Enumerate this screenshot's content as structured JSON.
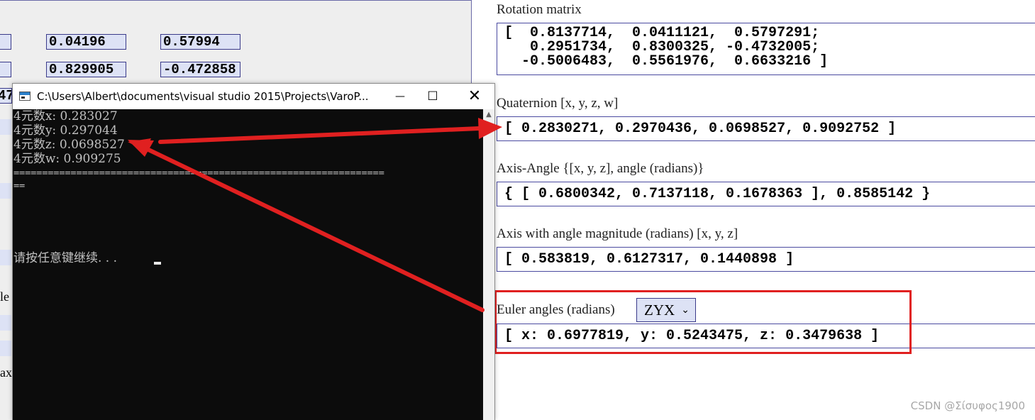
{
  "left_panel": {
    "row1": [
      "0.04196",
      "0.57994"
    ],
    "row2": [
      "0.829905",
      "-0.472858"
    ],
    "partial_row": "47",
    "fragments": [
      "le",
      "ax"
    ]
  },
  "console": {
    "title": "C:\\Users\\Albert\\documents\\visual studio 2015\\Projects\\VaroP...",
    "lines": [
      "4元数x: 0.283027",
      "4元数y: 0.297044",
      "4元数z: 0.0698527",
      "4元数w: 0.909275"
    ],
    "separator": "=================================================================",
    "separator_tail": "==",
    "prompt": "请按任意键继续. . . "
  },
  "rotation": {
    "label": "Rotation matrix",
    "rows": [
      "[  0.8137714,  0.0411121,  0.5797291;",
      "   0.2951734,  0.8300325, -0.4732005;",
      "  -0.5006483,  0.5561976,  0.6633216 ]"
    ]
  },
  "quaternion": {
    "label": "Quaternion [x, y, z, w]",
    "value": "[ 0.2830271, 0.2970436, 0.0698527, 0.9092752 ]"
  },
  "axis_angle": {
    "label": "Axis-Angle {[x, y, z], angle (radians)}",
    "value": "{ [ 0.6800342, 0.7137118, 0.1678363 ], 0.8585142 }"
  },
  "axis_magnitude": {
    "label": "Axis with angle magnitude (radians) [x, y, z]",
    "value": "[ 0.583819, 0.6127317, 0.1440898 ]"
  },
  "euler": {
    "label": "Euler angles (radians)",
    "order_selected": "ZYX",
    "value": "[ x: 0.6977819, y: 0.5243475, z: 0.3479638 ]"
  },
  "watermark": "CSDN @Σίσυφος1900",
  "colors": {
    "annotation_red": "#e02020",
    "box_border": "#4a4aa0",
    "cell_fill": "#dde2f5",
    "console_bg": "#0c0c0c",
    "console_text": "#c0c0c0"
  }
}
